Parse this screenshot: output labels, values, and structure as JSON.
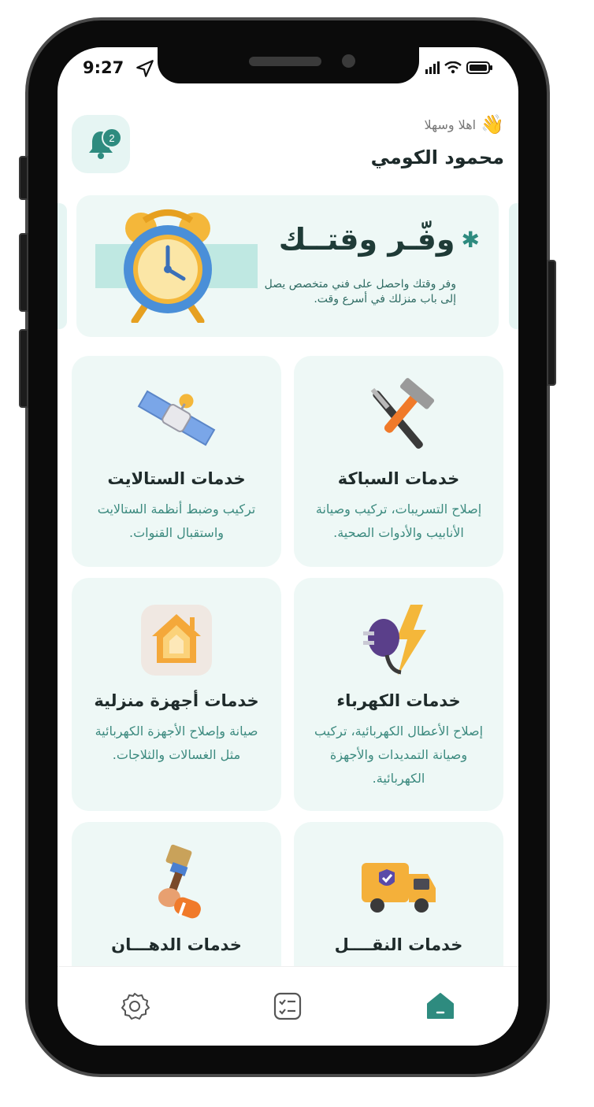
{
  "status_bar": {
    "time": "9:27"
  },
  "header": {
    "greeting": "اهلا وسهلا",
    "user_name": "محمود الكومي",
    "notification_count": "2"
  },
  "banner": {
    "title": "وفّـر وقتــك",
    "description": "وفر وقتك واحصل على فني متخصص يصل إلى باب منزلك في أسرع وقت."
  },
  "services": [
    {
      "title": "خدمات السباكة",
      "description": "إصلاح التسريبات، تركيب وصيانة الأنابيب والأدوات الصحية.",
      "icon": "tools-icon"
    },
    {
      "title": "خدمات الستالايت",
      "description": "تركيب وضبط أنظمة الستالايت واستقبال القنوات.",
      "icon": "satellite-icon"
    },
    {
      "title": "خدمات الكهرباء",
      "description": "إصلاح الأعطال الكهربائية، تركيب وصيانة التمديدات والأجهزة الكهربائية.",
      "icon": "plug-lightning-icon"
    },
    {
      "title": "خدمات أجهزة منزلية",
      "description": "صيانة وإصلاح الأجهزة الكهربائية مثل الغسالات والثلاجات.",
      "icon": "home-appliance-icon"
    },
    {
      "title": "خدمات النقــــل",
      "description": "",
      "icon": "truck-icon"
    },
    {
      "title": "خدمات الدهـــان",
      "description": "",
      "icon": "paint-brush-icon"
    }
  ],
  "bottom_nav": {
    "items": [
      "home-icon",
      "checklist-icon",
      "settings-icon"
    ],
    "active": "home-icon"
  },
  "colors": {
    "accent": "#2e8b7f",
    "card_bg": "#eef8f6",
    "text_teal": "#3c8a7f"
  }
}
